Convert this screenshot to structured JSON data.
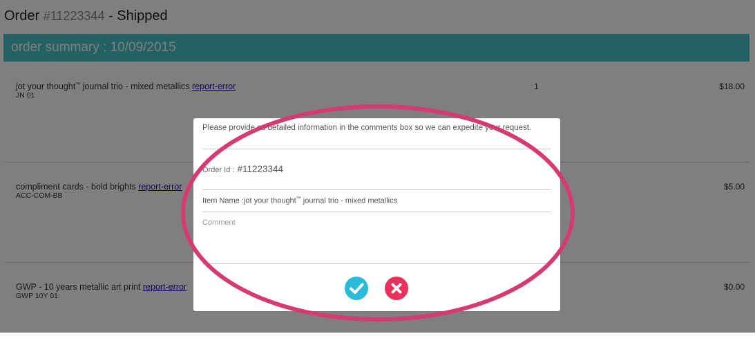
{
  "order": {
    "label": "Order",
    "number": "#11223344",
    "status": "- Shipped"
  },
  "summary": {
    "title": "order summary : 10/09/2015"
  },
  "items": [
    {
      "name": "jot your thought",
      "tm": "™",
      "name_rest": " journal trio - mixed metallics ",
      "link": "report-error",
      "sku": "JN 01",
      "qty": "1",
      "price": "$18.00"
    },
    {
      "name": "compliment cards - bold brights ",
      "link": "report-error",
      "sku": "ACC-COM-BB",
      "price": "$5.00"
    },
    {
      "name": "GWP - 10 years metallic art print ",
      "link": "report-error",
      "sku": "GWP 10Y 01",
      "price": "$0.00"
    }
  ],
  "modal": {
    "instructions": "Please provide as detailed information in the comments box so we can expedite your request.",
    "order_id_label": "Order Id :",
    "order_id_value": "#11223344",
    "item_name_label": "Item Name :jot your thought",
    "item_name_tm": "™",
    "item_name_rest": " journal trio - mixed metallics",
    "comment_placeholder": "Comment",
    "confirm_icon": "checkmark-icon",
    "cancel_icon": "close-icon"
  },
  "colors": {
    "accent": "#46c3c6",
    "confirm": "#2bbbd8",
    "cancel": "#e8325a",
    "annotation": "#d63a72"
  }
}
